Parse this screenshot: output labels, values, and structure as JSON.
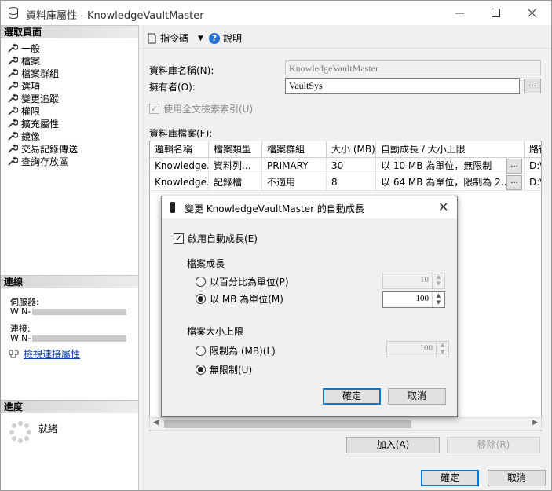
{
  "window": {
    "title": "資料庫屬性 - KnowledgeVaultMaster"
  },
  "left": {
    "select_page_header": "選取頁面",
    "pages": [
      "一般",
      "檔案",
      "檔案群組",
      "選項",
      "變更追蹤",
      "權限",
      "擴充屬性",
      "鏡像",
      "交易記錄傳送",
      "查詢存放區"
    ],
    "connection_header": "連線",
    "server_label": "伺服器:",
    "server_value": "WIN-",
    "connection_label": "連接:",
    "connection_value": "WIN-",
    "view_conn_props": "檢視連接屬性",
    "progress_header": "進度",
    "progress_status": "就緒"
  },
  "toolbar": {
    "script_label": "指令碼",
    "help_label": "說明"
  },
  "form": {
    "db_name_label": "資料庫名稱(N):",
    "db_name_value": "KnowledgeVaultMaster",
    "owner_label": "擁有者(O):",
    "owner_value": "VaultSys",
    "browse_label": "...",
    "fulltext_label": "使用全文檢索索引(U)",
    "files_label": "資料庫檔案(F):"
  },
  "grid": {
    "columns": [
      "邏輯名稱",
      "檔案類型",
      "檔案群組",
      "大小 (MB)",
      "自動成長 / 大小上限",
      "路徑"
    ],
    "rows": [
      [
        "Knowledge...",
        "資料列...",
        "PRIMARY",
        "30",
        "以 10 MB 為單位，無限制",
        "D:\\"
      ],
      [
        "Knowledge...",
        "記錄檔",
        "不適用",
        "8",
        "以 64 MB 為單位，限制為 2...",
        "D:\\"
      ]
    ]
  },
  "buttons": {
    "add": "加入(A)",
    "remove": "移除(R)",
    "ok": "確定",
    "cancel": "取消"
  },
  "dialog": {
    "title": "變更 KnowledgeVaultMaster 的自動成長",
    "enable_label": "啟用自動成長(E)",
    "file_growth_label": "檔案成長",
    "percent_label": "以百分比為單位(P)",
    "percent_value": "10",
    "mb_label": "以 MB 為單位(M)",
    "mb_value": "100",
    "max_size_label": "檔案大小上限",
    "limit_label": "限制為 (MB)(L)",
    "limit_value": "100",
    "unlimited_label": "無限制(U)",
    "ok": "確定",
    "cancel": "取消"
  }
}
